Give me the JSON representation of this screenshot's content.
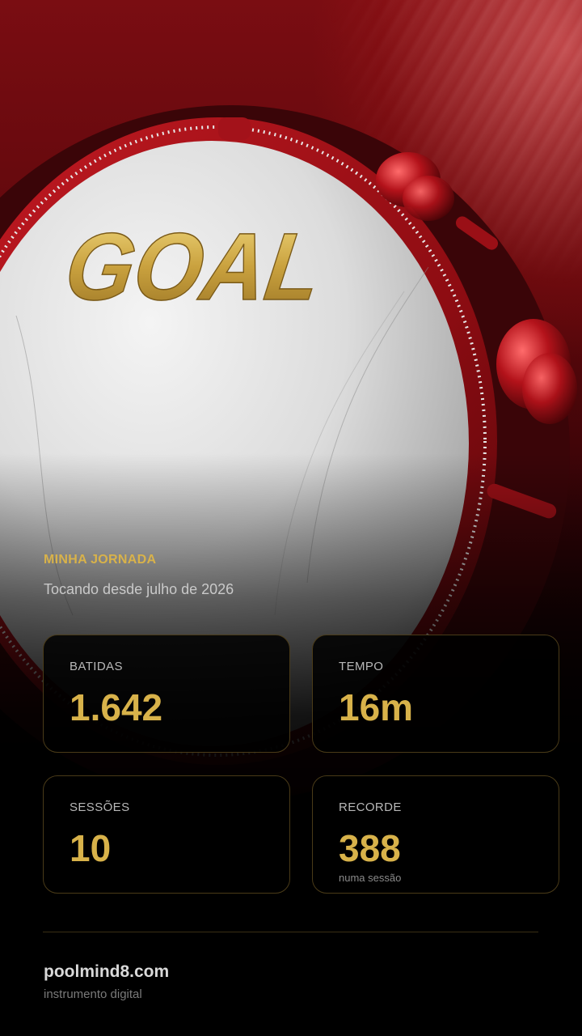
{
  "hero": {
    "logo_text": "GOAL",
    "icon": "pandeiro-tambourine",
    "accent": "#d8b24a",
    "background": "#7a0d12"
  },
  "journey": {
    "title": "MINHA JORNADA",
    "subtitle": "Tocando desde julho de 2026"
  },
  "stats": {
    "batidas": {
      "label": "BATIDAS",
      "value": "1.642"
    },
    "tempo": {
      "label": "TEMPO",
      "value": "16m"
    },
    "sessoes": {
      "label": "SESSÕES",
      "value": "10"
    },
    "recorde": {
      "label": "RECORDE",
      "value": "388",
      "note": "numa sessão"
    }
  },
  "footer": {
    "brand": "poolmind8.com",
    "tagline": "instrumento digital"
  }
}
